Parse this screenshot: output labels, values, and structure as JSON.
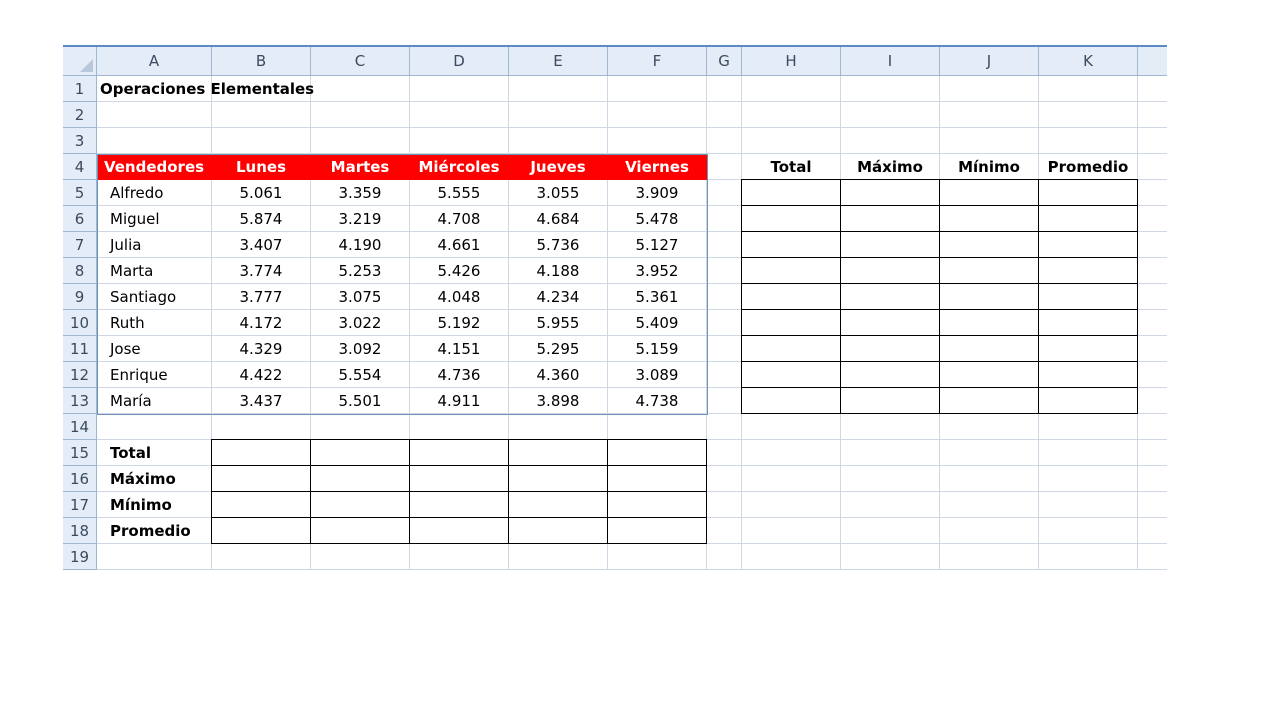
{
  "columns": [
    "A",
    "B",
    "C",
    "D",
    "E",
    "F",
    "G",
    "H",
    "I",
    "J",
    "K"
  ],
  "rows": [
    "1",
    "2",
    "3",
    "4",
    "5",
    "6",
    "7",
    "8",
    "9",
    "10",
    "11",
    "12",
    "13",
    "14",
    "15",
    "16",
    "17",
    "18",
    "19"
  ],
  "title": "Operaciones Elementales",
  "header_fill_color": "#ff0000",
  "sales_table": {
    "headers": [
      "Vendedores",
      "Lunes",
      "Martes",
      "Miércoles",
      "Jueves",
      "Viernes"
    ],
    "rows": [
      {
        "name": "Alfredo",
        "values": [
          "5.061",
          "3.359",
          "5.555",
          "3.055",
          "3.909"
        ]
      },
      {
        "name": "Miguel",
        "values": [
          "5.874",
          "3.219",
          "4.708",
          "4.684",
          "5.478"
        ]
      },
      {
        "name": "Julia",
        "values": [
          "3.407",
          "4.190",
          "4.661",
          "5.736",
          "5.127"
        ]
      },
      {
        "name": "Marta",
        "values": [
          "3.774",
          "5.253",
          "5.426",
          "4.188",
          "3.952"
        ]
      },
      {
        "name": "Santiago",
        "values": [
          "3.777",
          "3.075",
          "4.048",
          "4.234",
          "5.361"
        ]
      },
      {
        "name": "Ruth",
        "values": [
          "4.172",
          "3.022",
          "5.192",
          "5.955",
          "5.409"
        ]
      },
      {
        "name": "Jose",
        "values": [
          "4.329",
          "3.092",
          "4.151",
          "5.295",
          "5.159"
        ]
      },
      {
        "name": "Enrique",
        "values": [
          "4.422",
          "5.554",
          "4.736",
          "4.360",
          "3.089"
        ]
      },
      {
        "name": "María",
        "values": [
          "3.437",
          "5.501",
          "4.911",
          "3.898",
          "4.738"
        ]
      }
    ]
  },
  "summary_headers": [
    "Total",
    "Máximo",
    "Mínimo",
    "Promedio"
  ],
  "summary_rows": [
    "Total",
    "Máximo",
    "Mínimo",
    "Promedio"
  ]
}
